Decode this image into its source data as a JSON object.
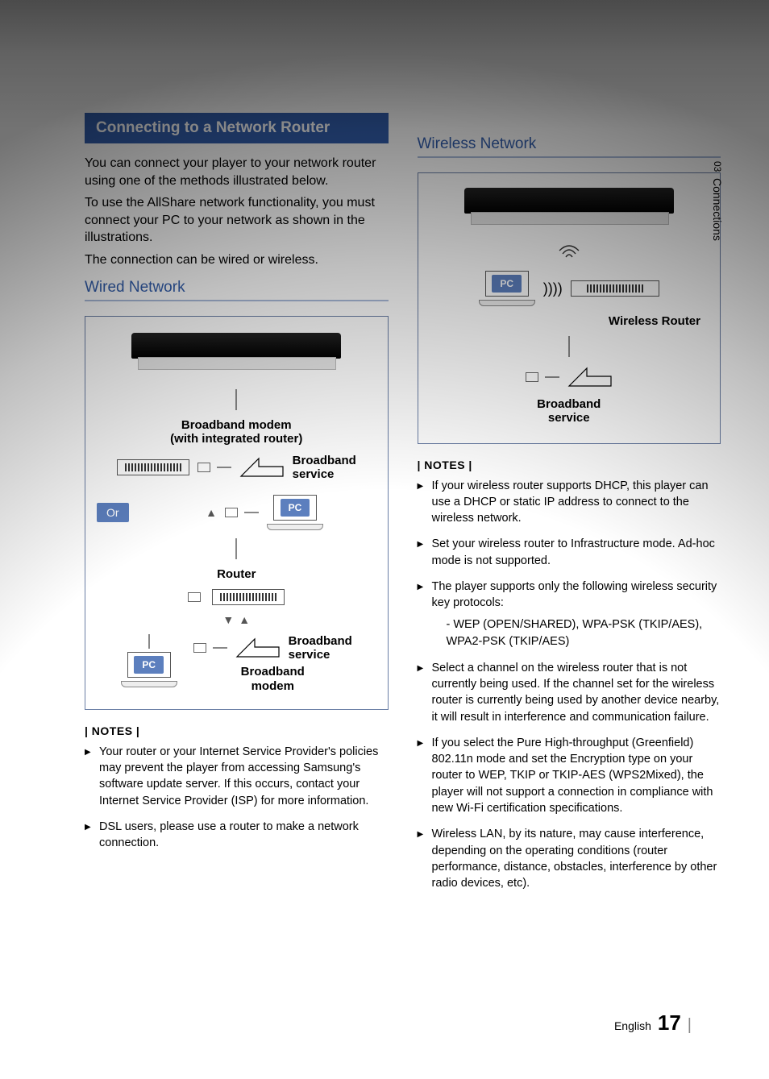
{
  "side": {
    "chapter_no": "03",
    "chapter_title": "Connections"
  },
  "left": {
    "banner": "Connecting to a Network Router",
    "intro1": "You can connect your player to your network router using one of the methods illustrated below.",
    "intro2": "To use the AllShare network functionality, you must connect your PC to your network as shown in the illustrations.",
    "intro3": "The connection can be wired or wireless.",
    "sub": "Wired Network",
    "diagram": {
      "modem_label": "Broadband modem\n(with integrated router)",
      "broadband_label": "Broadband\nservice",
      "or_label": "Or",
      "pc_label": "PC",
      "router_label": "Router",
      "broadband_modem_label": "Broadband\nmodem"
    },
    "notes_head": "| NOTES |",
    "notes": [
      "Your router or your Internet Service Provider's policies may prevent the player from accessing Samsung's software update server. If this occurs, contact your Internet Service Provider (ISP) for more information.",
      "DSL users, please use a router to make a network connection."
    ]
  },
  "right": {
    "sub": "Wireless Network",
    "diagram": {
      "pc_label": "PC",
      "wireless_router_label": "Wireless Router",
      "broadband_label": "Broadband\nservice"
    },
    "notes_head": "| NOTES |",
    "notes": [
      "If your wireless router supports DHCP, this player can use a DHCP or static IP address to connect to the wireless network.",
      "Set your wireless router to Infrastructure mode. Ad-hoc mode is not supported.",
      "The player supports only the following wireless security key protocols:",
      "Select a channel on the wireless router that is not currently being used. If the channel set for the wireless router is currently being used by another device nearby, it will result in interference and communication failure.",
      "If you select the Pure High-throughput (Greenfield) 802.11n mode and set the Encryption type on your router to WEP, TKIP or TKIP-AES (WPS2Mixed), the player will not support a connection in compliance with new Wi-Fi certification specifications.",
      "Wireless LAN, by its nature, may cause interference, depending on the operating conditions (router performance, distance, obstacles, interference by other radio devices, etc)."
    ],
    "note3_sub": "WEP (OPEN/SHARED), WPA-PSK (TKIP/AES), WPA2-PSK (TKIP/AES)"
  },
  "footer": {
    "lang": "English",
    "page": "17"
  }
}
